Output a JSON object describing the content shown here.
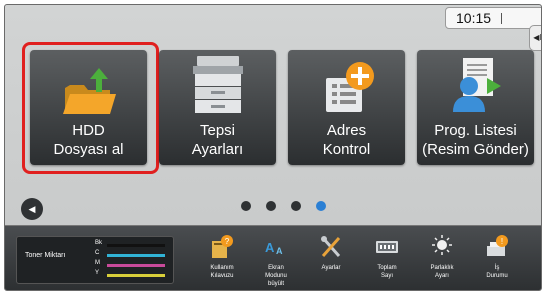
{
  "status": {
    "time": "10:15"
  },
  "tiles": [
    {
      "name": "hdd-dosyasi-al",
      "line1": "HDD",
      "line2": "Dosyası al",
      "icon": "folder-upload-icon"
    },
    {
      "name": "tepsi-ayarlari",
      "line1": "Tepsi",
      "line2": "Ayarları",
      "icon": "printer-tray-icon"
    },
    {
      "name": "adres-kontrol",
      "line1": "Adres",
      "line2": "Kontrol",
      "icon": "address-book-add-icon"
    },
    {
      "name": "prog-listesi",
      "line1": "Prog. Listesi",
      "line2": "(Resim Gönder)",
      "icon": "program-list-user-icon"
    }
  ],
  "pager": {
    "pages": 4,
    "active_index": 3
  },
  "toner": {
    "title": "Toner Miktarı",
    "rows": [
      {
        "label": "Bk",
        "color": "#111111",
        "level": 1.0
      },
      {
        "label": "C",
        "color": "#31b3d6",
        "level": 1.0
      },
      {
        "label": "M",
        "color": "#c84a9a",
        "level": 1.0
      },
      {
        "label": "Y",
        "color": "#d8cf3a",
        "level": 1.0
      }
    ]
  },
  "footer": {
    "kullanim": {
      "l1": "Kullanım",
      "l2": "Kılavuzu"
    },
    "ekran": {
      "l1": "Ekran",
      "l2": "Modunu",
      "l3": "büyült"
    },
    "ayarlar": {
      "l1": "Ayarlar"
    },
    "toplam": {
      "l1": "Toplam",
      "l2": "Sayı"
    },
    "parlaklik": {
      "l1": "Parlaklık",
      "l2": "Ayarı"
    },
    "is": {
      "l1": "İş",
      "l2": "Durumu"
    }
  },
  "colors": {
    "highlight": "#e0201f",
    "active_dot": "#2a7fd4",
    "accent_green": "#4caf3c",
    "accent_orange": "#f39a1e"
  }
}
